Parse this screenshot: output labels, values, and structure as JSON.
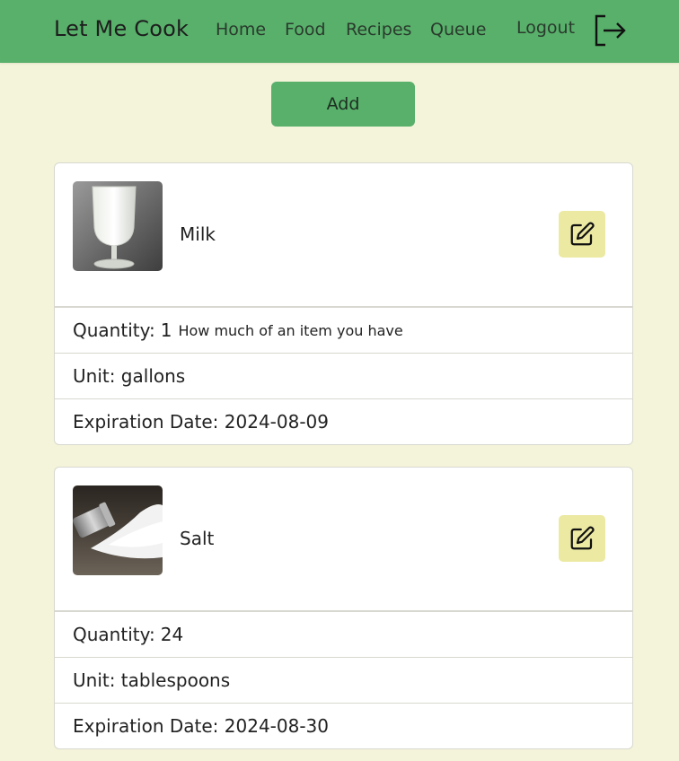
{
  "nav": {
    "brand": "Let Me Cook",
    "links": [
      "Home",
      "Food",
      "Recipes",
      "Queue"
    ],
    "logout": "Logout"
  },
  "actions": {
    "add_label": "Add"
  },
  "items": [
    {
      "name": "Milk",
      "quantity_label": "Quantity:",
      "quantity": "1",
      "quantity_hint": "How much of an item you have",
      "unit": "Unit: gallons",
      "expiration": "Expiration Date: 2024-08-09"
    },
    {
      "name": "Salt",
      "quantity_label": "Quantity:",
      "quantity": "24",
      "quantity_hint": "",
      "unit": "Unit: tablespoons",
      "expiration": "Expiration Date: 2024-08-30"
    }
  ],
  "colors": {
    "navbar": "#58b06b",
    "background": "#f4f4da",
    "edit_button": "#ece9a3"
  }
}
